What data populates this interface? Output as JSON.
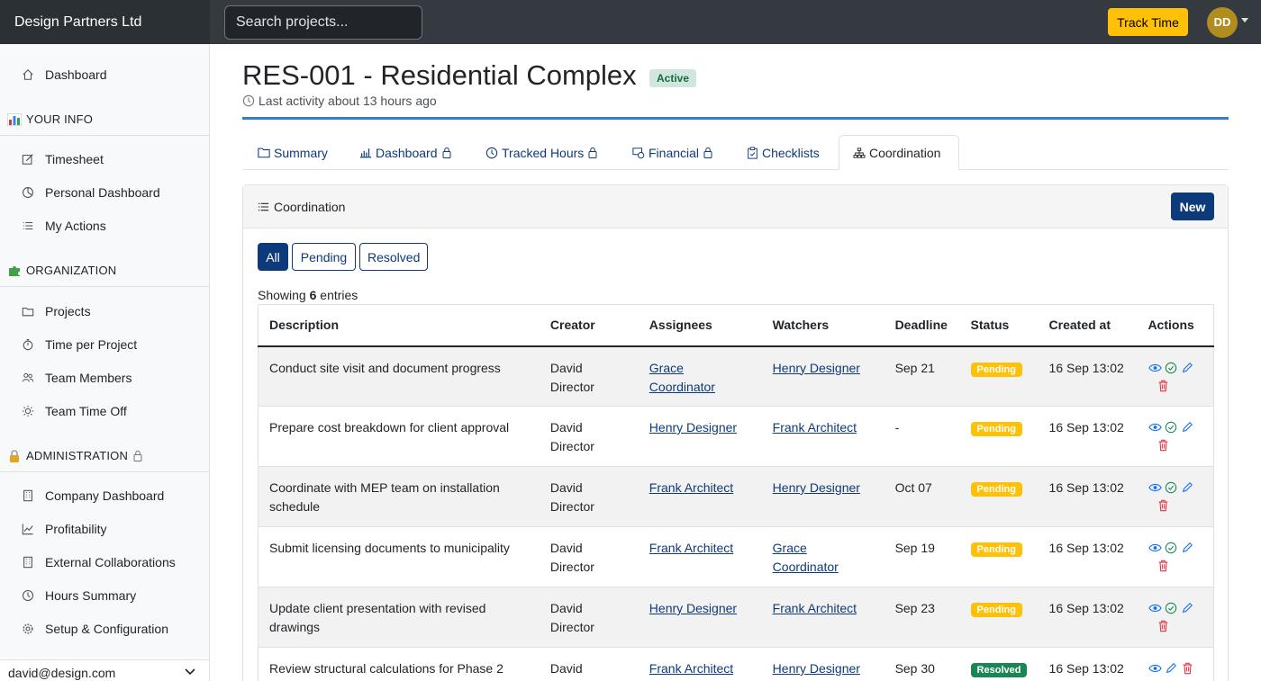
{
  "topbar": {
    "brand": "Design Partners Ltd",
    "search_placeholder": "Search projects...",
    "track_time_label": "Track Time",
    "avatar_initials": "DD"
  },
  "sidebar": {
    "dashboard": "Dashboard",
    "section_your_info": "YOUR INFO",
    "timesheet": "Timesheet",
    "personal_dashboard": "Personal Dashboard",
    "my_actions": "My Actions",
    "section_organization": "ORGANIZATION",
    "projects": "Projects",
    "time_per_project": "Time per Project",
    "team_members": "Team Members",
    "team_time_off": "Team Time Off",
    "section_administration": "ADMINISTRATION",
    "company_dashboard": "Company Dashboard",
    "profitability": "Profitability",
    "external_collaborations": "External Collaborations",
    "hours_summary": "Hours Summary",
    "setup_configuration": "Setup & Configuration",
    "user_email": "david@design.com"
  },
  "page": {
    "title": "RES-001 - Residential Complex",
    "status_badge": "Active",
    "last_activity": "Last activity about 13 hours ago"
  },
  "tabs": {
    "summary": "Summary",
    "dashboard": "Dashboard",
    "tracked_hours": "Tracked Hours",
    "financial": "Financial",
    "checklists": "Checklists",
    "coordination": "Coordination"
  },
  "card": {
    "title": "Coordination",
    "new_label": "New",
    "filters": {
      "all": "All",
      "pending": "Pending",
      "resolved": "Resolved"
    },
    "showing_prefix": "Showing",
    "showing_count": "6",
    "showing_suffix": "entries"
  },
  "table": {
    "headers": {
      "description": "Description",
      "creator": "Creator",
      "assignees": "Assignees",
      "watchers": "Watchers",
      "deadline": "Deadline",
      "status": "Status",
      "created_at": "Created at",
      "actions": "Actions"
    },
    "rows": [
      {
        "description": "Conduct site visit and document progress",
        "creator": "David Director",
        "assignee": "Grace Coordinator",
        "watcher": "Henry Designer",
        "deadline": "Sep 21",
        "status": "Pending",
        "created": "16 Sep 13:02"
      },
      {
        "description": "Prepare cost breakdown for client approval",
        "creator": "David Director",
        "assignee": "Henry Designer",
        "watcher": "Frank Architect",
        "deadline": "-",
        "status": "Pending",
        "created": "16 Sep 13:02"
      },
      {
        "description": "Coordinate with MEP team on installation schedule",
        "creator": "David Director",
        "assignee": "Frank Architect",
        "watcher": "Henry Designer",
        "deadline": "Oct 07",
        "status": "Pending",
        "created": "16 Sep 13:02"
      },
      {
        "description": "Submit licensing documents to municipality",
        "creator": "David Director",
        "assignee": "Frank Architect",
        "watcher": "Grace Coordinator",
        "deadline": "Sep 19",
        "status": "Pending",
        "created": "16 Sep 13:02"
      },
      {
        "description": "Update client presentation with revised drawings",
        "creator": "David Director",
        "assignee": "Henry Designer",
        "watcher": "Frank Architect",
        "deadline": "Sep 23",
        "status": "Pending",
        "created": "16 Sep 13:02"
      },
      {
        "description": "Review structural calculations for Phase 2",
        "creator": "David Director",
        "assignee": "Frank Architect",
        "watcher": "Henry Designer",
        "deadline": "Sep 30",
        "status": "Resolved",
        "created": "16 Sep 13:02"
      }
    ]
  },
  "colors": {
    "accent_navy": "#0d3a7a",
    "topbar": "#343a40",
    "pending": "#ffc107",
    "resolved": "#198754",
    "active_badge_bg": "#d1e7dd",
    "rule_blue": "#2f80d1",
    "delete_red": "#dc3545"
  }
}
